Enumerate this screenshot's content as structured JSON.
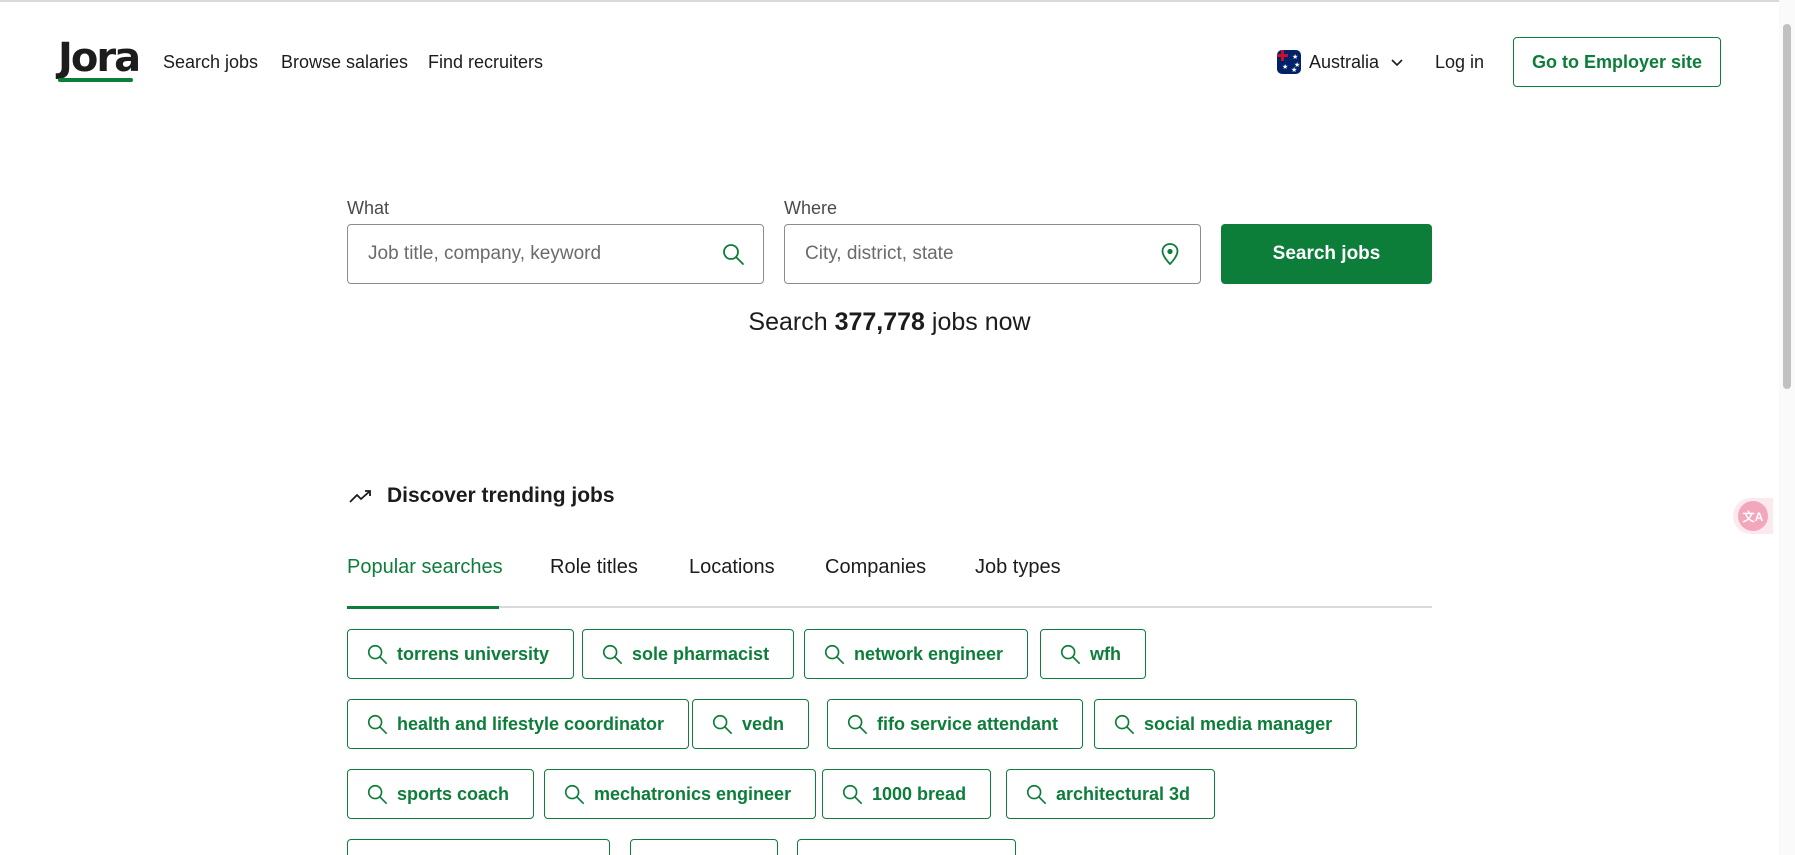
{
  "header": {
    "logo": "Jora",
    "nav": [
      "Search jobs",
      "Browse salaries",
      "Find recruiters"
    ],
    "country": "Australia",
    "login": "Log in",
    "employer_button": "Go to Employer site"
  },
  "search": {
    "what_label": "What",
    "what_placeholder": "Job title, company, keyword",
    "where_label": "Where",
    "where_placeholder": "City, district, state",
    "button": "Search jobs",
    "count_prefix": "Search",
    "count": "377,778",
    "count_suffix": "jobs now"
  },
  "trending": {
    "title": "Discover trending jobs",
    "tabs": [
      "Popular searches",
      "Role titles",
      "Locations",
      "Companies",
      "Job types"
    ],
    "active_tab": "Popular searches",
    "chips": [
      "torrens university",
      "sole pharmacist",
      "network engineer",
      "wfh",
      "health and lifestyle coordinator",
      "vedn",
      "fifo service attendant",
      "social media manager",
      "sports coach",
      "mechatronics engineer",
      "1000 bread",
      "architectural 3d"
    ]
  },
  "translate_button": "文A",
  "colors": {
    "brand_green": "#0d7d3a",
    "text": "#1c1c1c",
    "border": "#8c8c8c"
  }
}
